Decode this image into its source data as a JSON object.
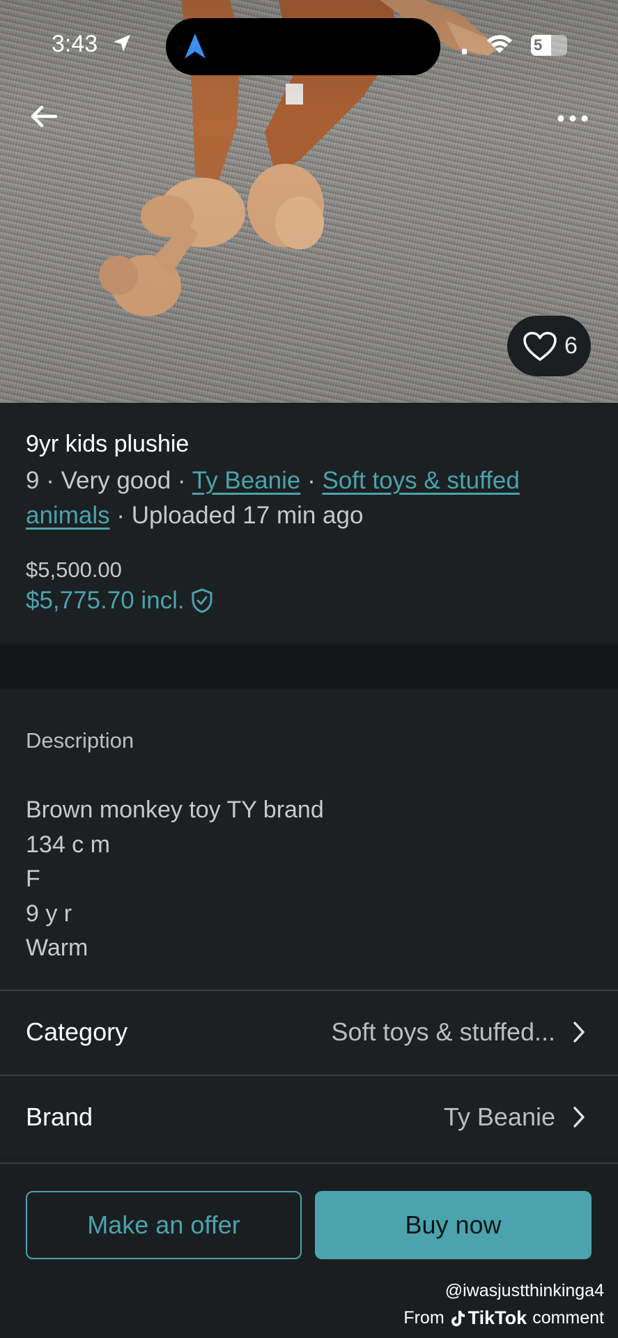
{
  "status_bar": {
    "time": "3:43",
    "battery": "5"
  },
  "listing": {
    "title": "9yr kids plushie",
    "size": "9",
    "condition": "Very good",
    "brand_link": "Ty Beanie",
    "category_link_line1": "Soft toys & stuffed",
    "category_link_line2": "animals",
    "uploaded": "Uploaded 17 min ago",
    "likes": "6",
    "price": "$5,500.00",
    "price_incl": "$5,775.70 incl."
  },
  "description": {
    "label": "Description",
    "lines": [
      "Brown monkey toy TY brand",
      "134 c m",
      "F",
      "9 y r",
      "Warm"
    ]
  },
  "details": {
    "category_label": "Category",
    "category_value": "Soft toys & stuffed...",
    "brand_label": "Brand",
    "brand_value": "Ty Beanie"
  },
  "actions": {
    "offer_label": "Make an offer",
    "buy_label": "Buy now"
  },
  "watermark": {
    "handle": "@iwasjustthinkinga4",
    "from": "From",
    "brand": "TikTok",
    "suffix": "comment"
  },
  "colors": {
    "accent": "#4aa3ad",
    "background": "#1c2022"
  }
}
